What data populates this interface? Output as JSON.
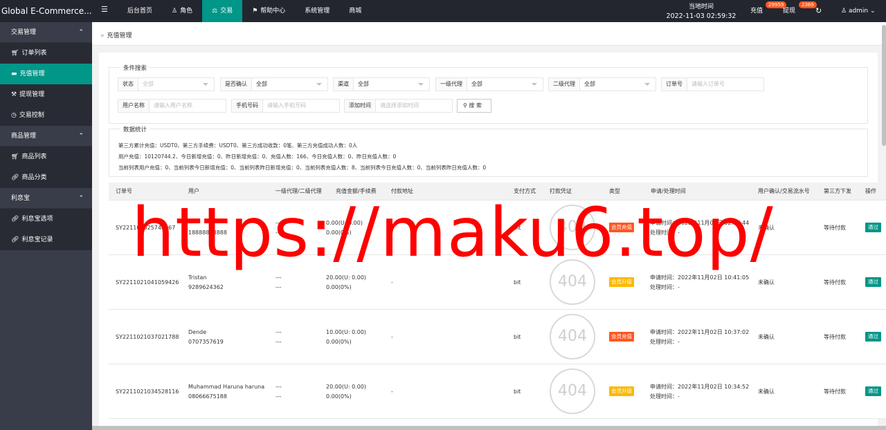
{
  "app": {
    "title": "Global E-Commerce..."
  },
  "topnav": {
    "items": [
      {
        "label": "后台首页",
        "icon": ""
      },
      {
        "label": "角色",
        "icon": "user-icon"
      },
      {
        "label": "交易",
        "icon": "scale-icon",
        "active": true
      },
      {
        "label": "帮助中心",
        "icon": "flag-icon"
      },
      {
        "label": "系统管理",
        "icon": ""
      },
      {
        "label": "商城",
        "icon": ""
      }
    ],
    "time_label": "当地时间",
    "time_value": "2022-11-03 02:59:32",
    "recharge_label": "充值",
    "recharge_badge": "29959",
    "withdraw_label": "提现",
    "withdraw_badge": "2369",
    "user_label": "admin"
  },
  "sidebar": {
    "groups": [
      {
        "label": "交易管理",
        "items": [
          {
            "label": "订单列表",
            "icon": "cart-icon"
          },
          {
            "label": "充值管理",
            "icon": "card-icon",
            "active": true
          },
          {
            "label": "提现管理",
            "icon": "gavel-icon"
          },
          {
            "label": "交易控制",
            "icon": "gauge-icon"
          }
        ]
      },
      {
        "label": "商品管理",
        "items": [
          {
            "label": "商品列表",
            "icon": "cart-icon"
          },
          {
            "label": "商品分类",
            "icon": "link-icon"
          }
        ]
      },
      {
        "label": "利息宝",
        "items": [
          {
            "label": "利息宝选项",
            "icon": "link-icon"
          },
          {
            "label": "利息宝记录",
            "icon": "link-icon"
          }
        ]
      }
    ]
  },
  "breadcrumb": {
    "label": "充值管理"
  },
  "search": {
    "legend": "条件搜索",
    "status": {
      "label": "状态",
      "value": "全部"
    },
    "confirm": {
      "label": "是否确认",
      "value": "全部"
    },
    "channel": {
      "label": "渠道",
      "value": "全部"
    },
    "agent1": {
      "label": "一级代理",
      "value": "全部"
    },
    "agent2": {
      "label": "二级代理",
      "value": "全部"
    },
    "order_no": {
      "label": "订单号",
      "placeholder": "请输入订单号"
    },
    "username": {
      "label": "用户名称",
      "placeholder": "请输入用户名称"
    },
    "phone": {
      "label": "手机号码",
      "placeholder": "请输入手机号码"
    },
    "add_time": {
      "label": "添加时间",
      "placeholder": "请选择添加时间"
    },
    "button": "搜 索"
  },
  "stats": {
    "legend": "数据统计",
    "line1": "第三方累计充值：USDT0、第三方手续费：USDT0、第三方成功收款：0笔、第三方充值成功人数：0人",
    "line2": "用户充值：10120744.2、今日新增充值：0、昨日新增充值：0、充值人数：166、今日充值人数：0、昨日充值人数：0",
    "line3": "当前列表用户充值：0、当前列表今日新增充值：0、当前列表昨日新增充值：0、当前列表充值人数：8、当前列表今日充值人数：0、当前列表昨日充值人数：0"
  },
  "table": {
    "headers": [
      "订单号",
      "用户",
      "一级代理/二级代理",
      "充值金额/手续费",
      "付款地址",
      "支付方式",
      "打款凭证",
      "类型",
      "申请/处理时间",
      "用户确认/交易流水号",
      "第三方下发",
      "操作"
    ],
    "rows": [
      {
        "order": "SY221103025744067",
        "name": "—",
        "phone": "18888883888",
        "agent1": "---",
        "agent2": "---",
        "amount": "0.00(U: 0.00)",
        "fee": "0.00(0%)",
        "address": "-",
        "pay": "bit",
        "proof": "404",
        "type": "会员充值",
        "type_color": "red",
        "apply": "申请时间：2022年11月03日 02:57:44",
        "handle": "处理时间：-",
        "confirm": "未确认",
        "third": "等待付款",
        "action": "通过"
      },
      {
        "order": "SY2211021041059426",
        "name": "Tristan",
        "phone": "9289624362",
        "agent1": "---",
        "agent2": "---",
        "amount": "20.00(U: 0.00)",
        "fee": "0.00(0%)",
        "address": "-",
        "pay": "bit",
        "proof": "404",
        "type": "会员升级",
        "type_color": "orange",
        "apply": "申请时间：2022年11月02日 10:41:05",
        "handle": "处理时间：-",
        "confirm": "未确认",
        "third": "等待付款",
        "action": "通过"
      },
      {
        "order": "SY2211021037021788",
        "name": "Dende",
        "phone": "0707357619",
        "agent1": "---",
        "agent2": "---",
        "amount": "10.00(U: 0.00)",
        "fee": "0.00(0%)",
        "address": "-",
        "pay": "bit",
        "proof": "404",
        "type": "会员充值",
        "type_color": "red",
        "apply": "申请时间：2022年11月02日 10:37:02",
        "handle": "处理时间：-",
        "confirm": "未确认",
        "third": "等待付款",
        "action": "通过"
      },
      {
        "order": "SY2211021034528116",
        "name": "Muhammad Haruna haruna",
        "phone": "08066675188",
        "agent1": "---",
        "agent2": "---",
        "amount": "20.00(U: 0.00)",
        "fee": "0.00(0%)",
        "address": "-",
        "pay": "bit",
        "proof": "404",
        "type": "会员升级",
        "type_color": "orange",
        "apply": "申请时间：2022年11月02日 10:34:52",
        "handle": "处理时间：-",
        "confirm": "未确认",
        "third": "等待付款",
        "action": "通过"
      }
    ]
  },
  "watermark": "https://maku6.top/",
  "colors": {
    "accent": "#009688",
    "topbar": "#23262e",
    "sidebar": "#393d49",
    "badge": "#ff5722",
    "tag_orange": "#ffb800",
    "watermark": "#ff0000"
  }
}
